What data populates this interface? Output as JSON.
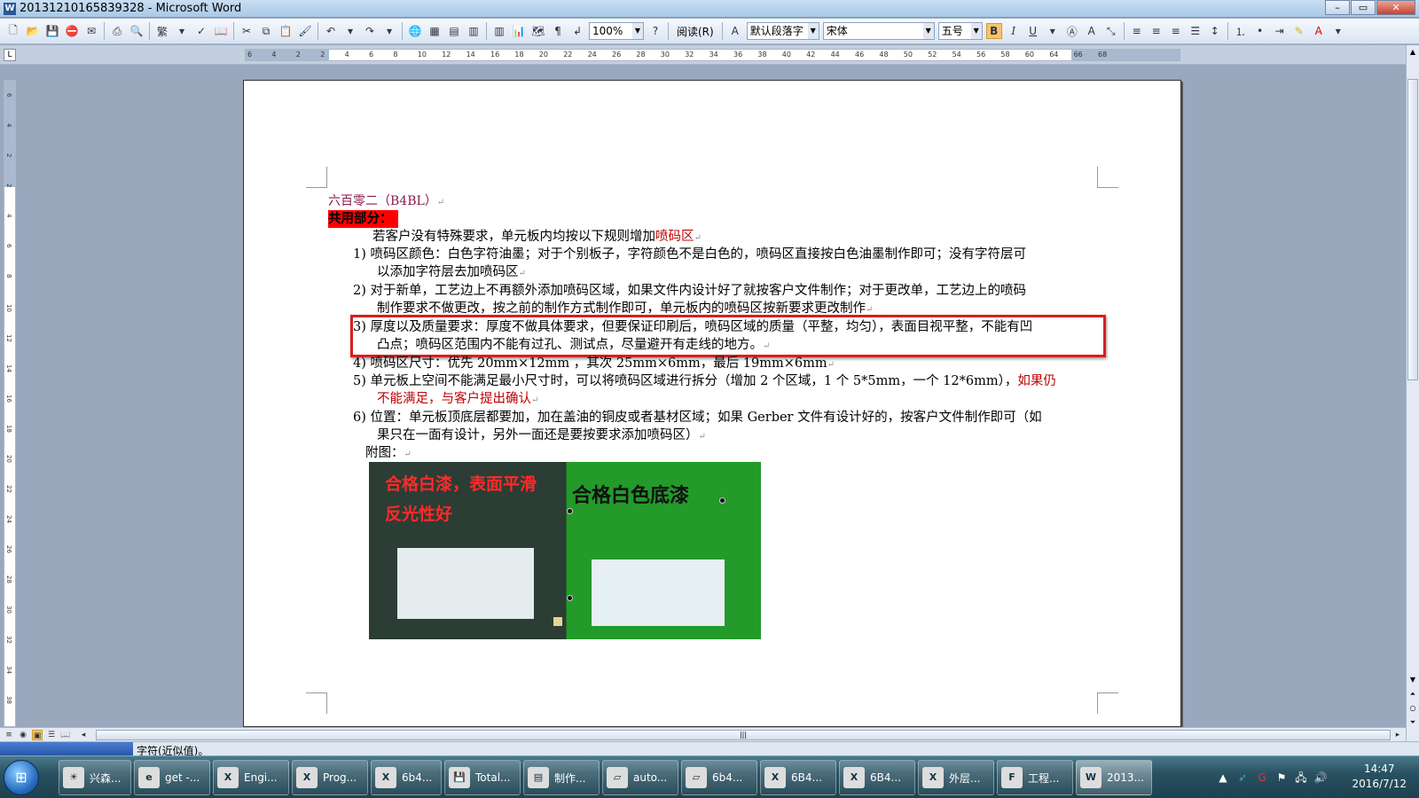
{
  "window": {
    "title": "20131210165839328 - Microsoft Word",
    "icon": "word-icon",
    "min": "–",
    "max": "▭",
    "close": "✕"
  },
  "toolbar": {
    "zoom": "100%",
    "read": "阅读(R)",
    "style": "默认段落字",
    "font": "宋体",
    "size": "五号",
    "bold": "B",
    "italic": "I",
    "underline": "U"
  },
  "ruler": {
    "corner": "L",
    "h_ticks": [
      "6",
      "4",
      "2",
      "2",
      "4",
      "6",
      "8",
      "10",
      "12",
      "14",
      "16",
      "18",
      "20",
      "22",
      "24",
      "26",
      "28",
      "30",
      "32",
      "34",
      "36",
      "38",
      "40",
      "42",
      "44",
      "46",
      "48",
      "50",
      "52",
      "54",
      "56",
      "58",
      "60",
      "64",
      "66",
      "68"
    ],
    "v_ticks": [
      "6",
      "4",
      "2",
      "2",
      "4",
      "6",
      "8",
      "10",
      "12",
      "14",
      "16",
      "18",
      "20",
      "22",
      "24",
      "26",
      "28",
      "30",
      "32",
      "34",
      "38"
    ]
  },
  "doc": {
    "heading": "六百零二（B4BL）",
    "common": "共用部分：",
    "intro_a": "若客户没有特殊要求，单元板内均按以下规则增加",
    "intro_b": "喷码区",
    "item1_a": "1)  喷码区颜色：白色字符油墨；对于个别板子，字符颜色不是白色的，喷码区直接按白色油墨制作即可；没有字符层可",
    "item1_b": "以添加字符层去加喷码区",
    "item2_a": "2)  对于新单，工艺边上不再额外添加喷码区域，如果文件内设计好了就按客户文件制作；对于更改单，工艺边上的喷码",
    "item2_b": "制作要求不做更改，按之前的制作方式制作即可，单元板内的喷码区按新要求更改制作",
    "item3_a": "3)  厚度以及质量要求：厚度不做具体要求，但要保证印刷后，喷码区域的质量（平整，均匀），表面目视平整，不能有凹",
    "item3_b": "凸点；喷码区范围内不能有过孔、测试点，尽量避开有走线的地方。",
    "item4": "4)  喷码区尺寸：优先 20mm×12mm ，其次 25mm×6mm，最后 19mm×6mm",
    "item5_a": "5)  单元板上空间不能满足最小尺寸时，可以将喷码区域进行拆分（增加 2 个区域，1 个 5*5mm，一个 12*6mm），",
    "item5_red1": "如果仍",
    "item5_red2": "不能满足，与客户提出确认",
    "item6_a": "6)  位置：单元板顶底层都要加，加在盖油的铜皮或者基材区域；如果 Gerber 文件有设计好的，按客户文件制作即可（如",
    "item6_b": "果只在一面有设计，另外一面还是要按要求添加喷码区）",
    "fig_label": "附图：",
    "fig_cap_left_1": "合格白漆，表面平滑",
    "fig_cap_left_2": "反光性好",
    "fig_cap_right": "合格白色底漆",
    "para_mark": "↵"
  },
  "status": {
    "text": "字符(近似值)。"
  },
  "taskbar": {
    "start": "⊞",
    "tasks": [
      {
        "label": "兴森...",
        "icon": "sun-icon"
      },
      {
        "label": "get -...",
        "icon": "ie-icon"
      },
      {
        "label": "Engi...",
        "icon": "excel-icon"
      },
      {
        "label": "Prog...",
        "icon": "excel-icon"
      },
      {
        "label": "6b4...",
        "icon": "excel-icon"
      },
      {
        "label": "Total...",
        "icon": "floppy-icon"
      },
      {
        "label": "制作...",
        "icon": "notepad-icon"
      },
      {
        "label": "auto...",
        "icon": "folder-icon"
      },
      {
        "label": "6b4...",
        "icon": "folder-icon"
      },
      {
        "label": "6B4...",
        "icon": "excel-icon"
      },
      {
        "label": "6B4...",
        "icon": "excel-icon"
      },
      {
        "label": "外层...",
        "icon": "excel-icon"
      },
      {
        "label": "工程...",
        "icon": "app-f-icon"
      },
      {
        "label": "2013...",
        "icon": "word-icon"
      }
    ],
    "time": "14:47",
    "date": "2016/7/12"
  }
}
